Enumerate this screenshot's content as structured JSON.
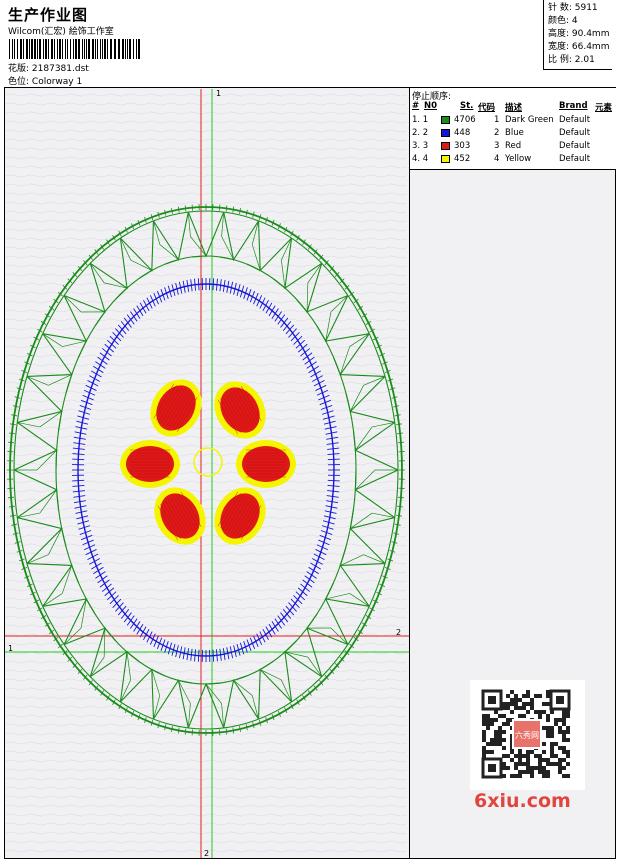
{
  "header": {
    "title": "生产作业图",
    "subtitle": "Wilcom(汇宏) 絵饰工作室",
    "pattern_label": "花版:",
    "pattern_value": "2187381.dst",
    "colorway_label": "色位:",
    "colorway_value": "Colorway 1"
  },
  "stats": {
    "stitches": "针 数: 5911",
    "colors": "颜色: 4",
    "height": "高度: 90.4mm",
    "width": "宽度: 66.4mm",
    "scale": "比 例: 2.01"
  },
  "panel": {
    "title": "停止顺序:",
    "columns": {
      "hash": "#",
      "no": "N0",
      "st": "St.",
      "code": "代码",
      "desc": "描述",
      "brand": "Brand",
      "element": "元素"
    },
    "rows": [
      {
        "order": "1. 1",
        "color": "#1a8c1a",
        "st": "4706",
        "code": "1",
        "desc": "Dark Green",
        "brand": "Default"
      },
      {
        "order": "2. 2",
        "color": "#1515d8",
        "st": "448",
        "code": "2",
        "desc": "Blue",
        "brand": "Default"
      },
      {
        "order": "3. 3",
        "color": "#e01818",
        "st": "303",
        "code": "3",
        "desc": "Red",
        "brand": "Default"
      },
      {
        "order": "4. 4",
        "color": "#f5f500",
        "st": "452",
        "code": "4",
        "desc": "Yellow",
        "brand": "Default"
      }
    ]
  },
  "axes": {
    "v_top": "1",
    "v_bottom": "2",
    "h_left": "1",
    "h_right": "2"
  },
  "watermark": {
    "logo_text": "6xiu.com",
    "seal_text": "六秀网"
  },
  "colors": {
    "green": "#1a8c1a",
    "blue": "#1515d8",
    "red": "#e01818",
    "yellow": "#f5f500",
    "axis_red": "#e02020",
    "axis_green": "#22cc22"
  }
}
